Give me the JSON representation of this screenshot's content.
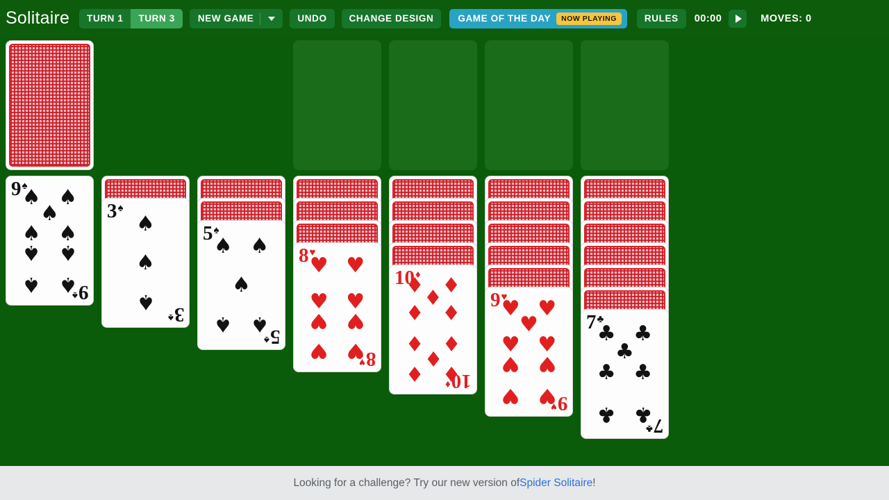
{
  "toolbar": {
    "brand": "Solitaire",
    "turn1_label": "TURN 1",
    "turn3_label": "TURN 3",
    "new_game_label": "NEW GAME",
    "new_game_caret_icon": "chevron-down-icon",
    "undo_label": "UNDO",
    "change_design_label": "CHANGE DESIGN",
    "game_of_the_day_label": "GAME OF THE DAY",
    "now_playing_badge": "NOW PLAYING",
    "rules_label": "RULES",
    "timer": "00:00",
    "play_icon": "play-icon",
    "moves_label": "MOVES: 0",
    "active_turn": "TURN 3",
    "accent_gotd": "#29a3c4",
    "accent_badge": "#f5c53d",
    "accent_button": "#17752a",
    "accent_active": "#3aa556"
  },
  "board": {
    "felt_color": "#0a5c0a",
    "slot_color": "#1a6b1a",
    "stock": {
      "face_down_count": 1,
      "label": "stock-pile"
    },
    "waste": {
      "cards": [],
      "label": "waste-pile"
    },
    "foundations": [
      {
        "suit": "spades",
        "cards": []
      },
      {
        "suit": "hearts",
        "cards": []
      },
      {
        "suit": "diamonds",
        "cards": []
      },
      {
        "suit": "clubs",
        "cards": []
      }
    ],
    "tableau": [
      {
        "index": 1,
        "face_down": 0,
        "face_up": [
          {
            "rank": "9",
            "suit": "spades"
          }
        ]
      },
      {
        "index": 2,
        "face_down": 1,
        "face_up": [
          {
            "rank": "3",
            "suit": "spades"
          }
        ]
      },
      {
        "index": 3,
        "face_down": 2,
        "face_up": [
          {
            "rank": "5",
            "suit": "spades"
          }
        ]
      },
      {
        "index": 4,
        "face_down": 3,
        "face_up": [
          {
            "rank": "8",
            "suit": "hearts"
          }
        ]
      },
      {
        "index": 5,
        "face_down": 4,
        "face_up": [
          {
            "rank": "10",
            "suit": "diamonds"
          }
        ]
      },
      {
        "index": 6,
        "face_down": 5,
        "face_up": [
          {
            "rank": "9",
            "suit": "hearts"
          }
        ]
      },
      {
        "index": 7,
        "face_down": 6,
        "face_up": [
          {
            "rank": "7",
            "suit": "clubs"
          }
        ]
      }
    ]
  },
  "footer": {
    "text_before": "Looking for a challenge? Try our new version of ",
    "link_text": "Spider Solitaire",
    "text_after": "!"
  }
}
